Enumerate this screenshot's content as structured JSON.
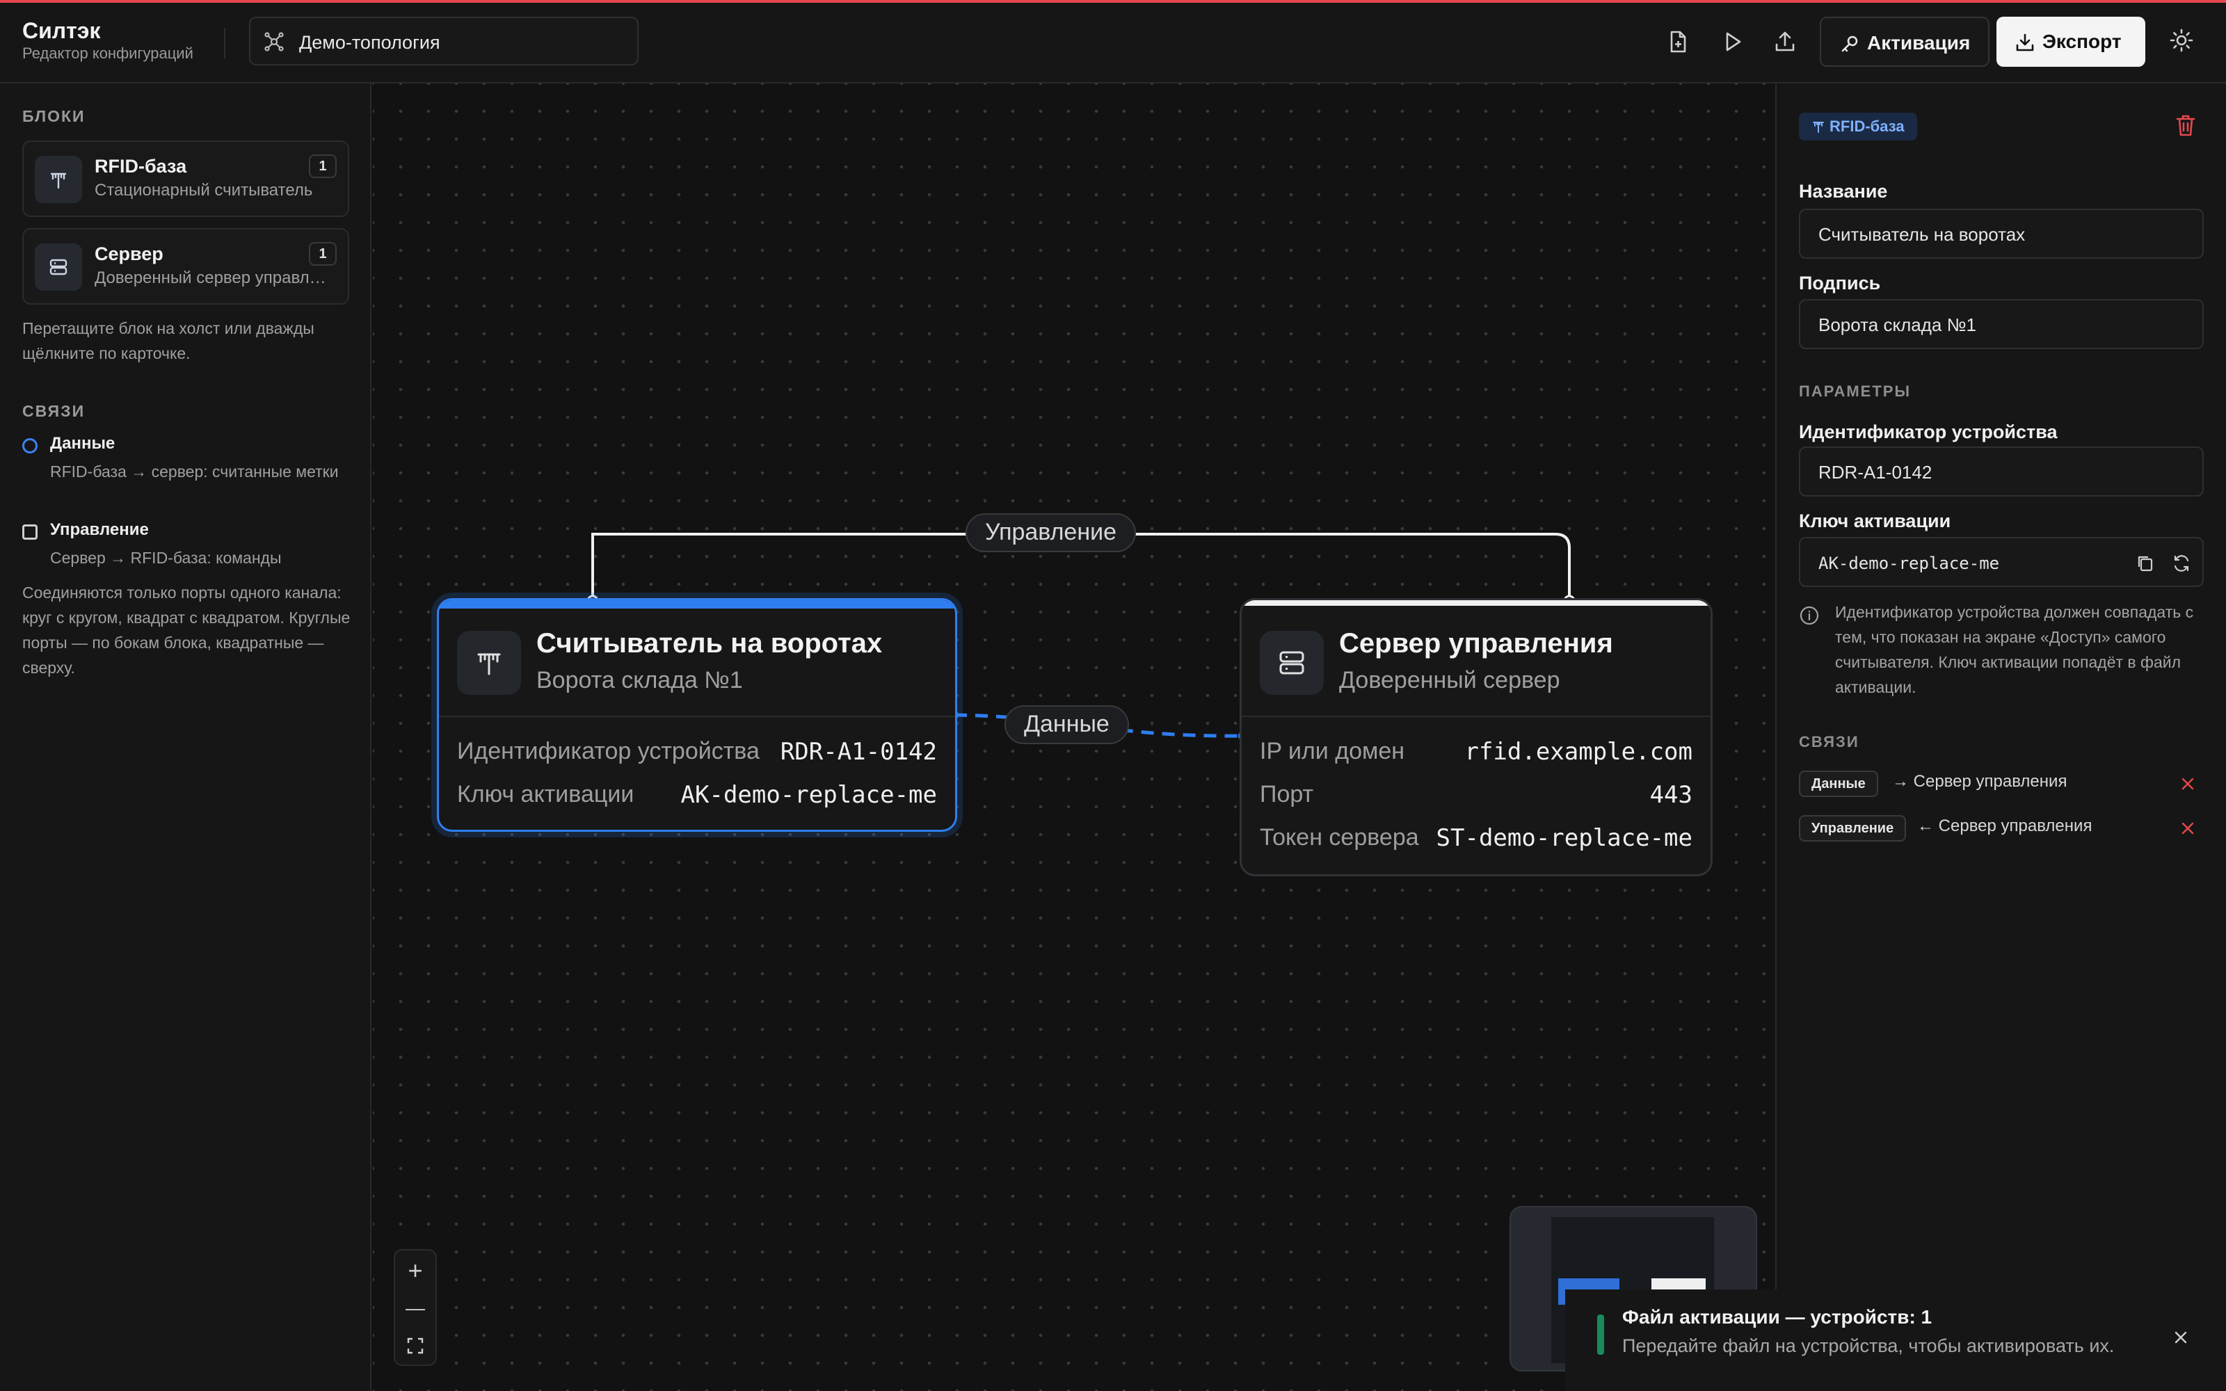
{
  "app": {
    "title": "Силтэк",
    "subtitle": "Редактор конфигураций"
  },
  "header": {
    "project_name": "Демо-топология",
    "buttons": {
      "activate": "Активация",
      "export": "Экспорт"
    },
    "icons": [
      "new-file-icon",
      "play-icon",
      "upload-icon",
      "key-icon",
      "download-icon",
      "sun-icon"
    ]
  },
  "sidebar": {
    "blocks_title": "БЛОКИ",
    "blocks": [
      {
        "name": "RFID-база",
        "desc": "Стационарный считыватель",
        "count": "1",
        "icon": "antenna-icon"
      },
      {
        "name": "Сервер",
        "desc": "Доверенный сервер управления",
        "count": "1",
        "icon": "server-icon"
      }
    ],
    "blocks_hint": "Перетащите блок на холст или дважды щёлкните по карточке.",
    "links_title": "СВЯЗИ",
    "links": [
      {
        "name": "Данные",
        "desc": "RFID-база → сервер: считанные метки",
        "port": "circle"
      },
      {
        "name": "Управление",
        "desc": "Сервер → RFID-база: команды",
        "port": "square"
      }
    ],
    "links_hint": "Соединяются только порты одного канала: круг с кругом, квадрат с квадратом. Круглые порты — по бокам блока, квадратные — сверху."
  },
  "canvas": {
    "edges": [
      {
        "label": "Управление",
        "style": "solid"
      },
      {
        "label": "Данные",
        "style": "dashed"
      }
    ],
    "nodes": [
      {
        "title": "Считыватель на воротах",
        "subtitle": "Ворота склада №1",
        "selected": true,
        "accent": "#2f7ef0",
        "fields": [
          {
            "key": "Идентификатор устройства",
            "value": "RDR-A1-0142"
          },
          {
            "key": "Ключ активации",
            "value": "AK-demo-replace-me"
          }
        ]
      },
      {
        "title": "Сервер управления",
        "subtitle": "Доверенный сервер",
        "selected": false,
        "accent": "#f0f0f0",
        "fields": [
          {
            "key": "IP или домен",
            "value": "rfid.example.com"
          },
          {
            "key": "Порт",
            "value": "443"
          },
          {
            "key": "Токен сервера",
            "value": "ST-demo-replace-me"
          }
        ]
      }
    ],
    "zoom": {
      "in": "+",
      "out": "—"
    }
  },
  "inspector": {
    "type_tag": "RFID-база",
    "name_label": "Название",
    "name_value": "Считыватель на воротах",
    "caption_label": "Подпись",
    "caption_value": "Ворота склада №1",
    "params_title": "ПАРАМЕТРЫ",
    "device_id_label": "Идентификатор устройства",
    "device_id_value": "RDR-A1-0142",
    "key_label": "Ключ активации",
    "key_value": "AK-demo-replace-me",
    "info_text": "Идентификатор устройства должен совпадать с тем, что показан на экране «Доступ» самого считывателя. Ключ активации попадёт в файл активации.",
    "links_title": "СВЯЗИ",
    "links": [
      {
        "pill": "Данные",
        "text": "→ Сервер управления"
      },
      {
        "pill": "Управление",
        "text": "← Сервер управления"
      }
    ]
  },
  "toast": {
    "title": "Файл активации — устройств: 1",
    "desc": "Передайте файл на устройства, чтобы активировать их."
  },
  "colors": {
    "accent": "#2f7ef0",
    "danger": "#e5484d",
    "success": "#1a8a5a"
  }
}
